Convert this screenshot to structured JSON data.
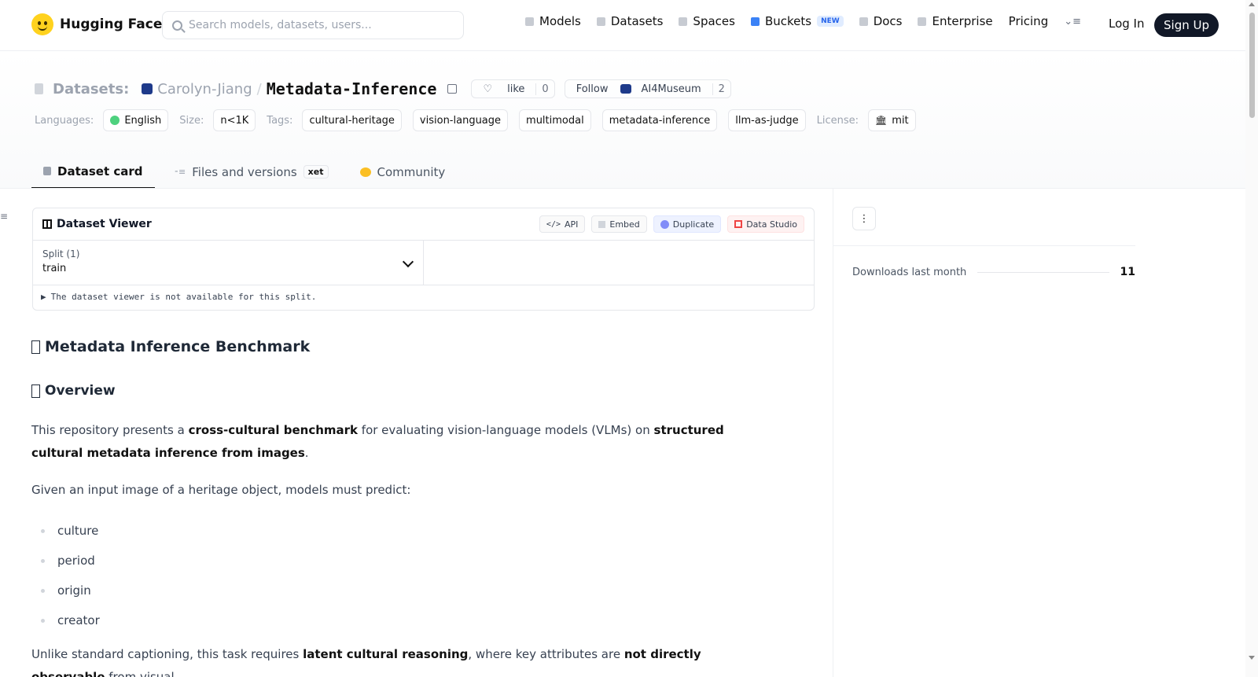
{
  "nav": {
    "brand": "Hugging Face",
    "search_placeholder": "Search models, datasets, users...",
    "links": [
      "Models",
      "Datasets",
      "Spaces",
      "Buckets",
      "Docs",
      "Enterprise",
      "Pricing"
    ],
    "buckets_badge": "NEW",
    "login": "Log In",
    "signup": "Sign Up"
  },
  "repo": {
    "type_label": "Datasets:",
    "owner": "Carolyn-Jiang",
    "separator": "/",
    "name": "Metadata-Inference",
    "like_label": "like",
    "like_count": "0",
    "follow_label": "Follow",
    "follow_org": "AI4Museum",
    "follow_count": "2"
  },
  "tags": {
    "languages_label": "Languages:",
    "language": "English",
    "size_label": "Size:",
    "size": "n<1K",
    "tags_label": "Tags:",
    "tag_list": [
      "cultural-heritage",
      "vision-language",
      "multimodal",
      "metadata-inference",
      "llm-as-judge"
    ],
    "license_label": "License:",
    "license": "mit"
  },
  "tabs": {
    "dataset_card": "Dataset card",
    "files": "Files and versions",
    "xet": "xet",
    "community": "Community"
  },
  "viewer": {
    "title": "Dataset Viewer",
    "buttons": [
      "API",
      "Embed",
      "Duplicate",
      "Data Studio"
    ],
    "split_label": "Split (1)",
    "split_value": "train",
    "notice": "The dataset viewer is not available for this split."
  },
  "card": {
    "h1": "Metadata Inference Benchmark",
    "h2": "Overview",
    "p1_a": "This repository presents a ",
    "p1_b": "cross-cultural benchmark",
    "p1_c": " for evaluating vision-language models (VLMs) on ",
    "p1_d": "structured cultural metadata inference from images",
    "p1_e": ".",
    "p2": "Given an input image of a heritage object, models must predict:",
    "list": [
      "culture",
      "period",
      "origin",
      "creator"
    ],
    "p3_a": "Unlike standard captioning, this task requires ",
    "p3_b": "latent cultural reasoning",
    "p3_c": ", where key attributes are ",
    "p3_d": "not directly observable",
    "p3_e": " from visual"
  },
  "sidebar": {
    "downloads_label": "Downloads last month",
    "downloads_value": "11"
  }
}
